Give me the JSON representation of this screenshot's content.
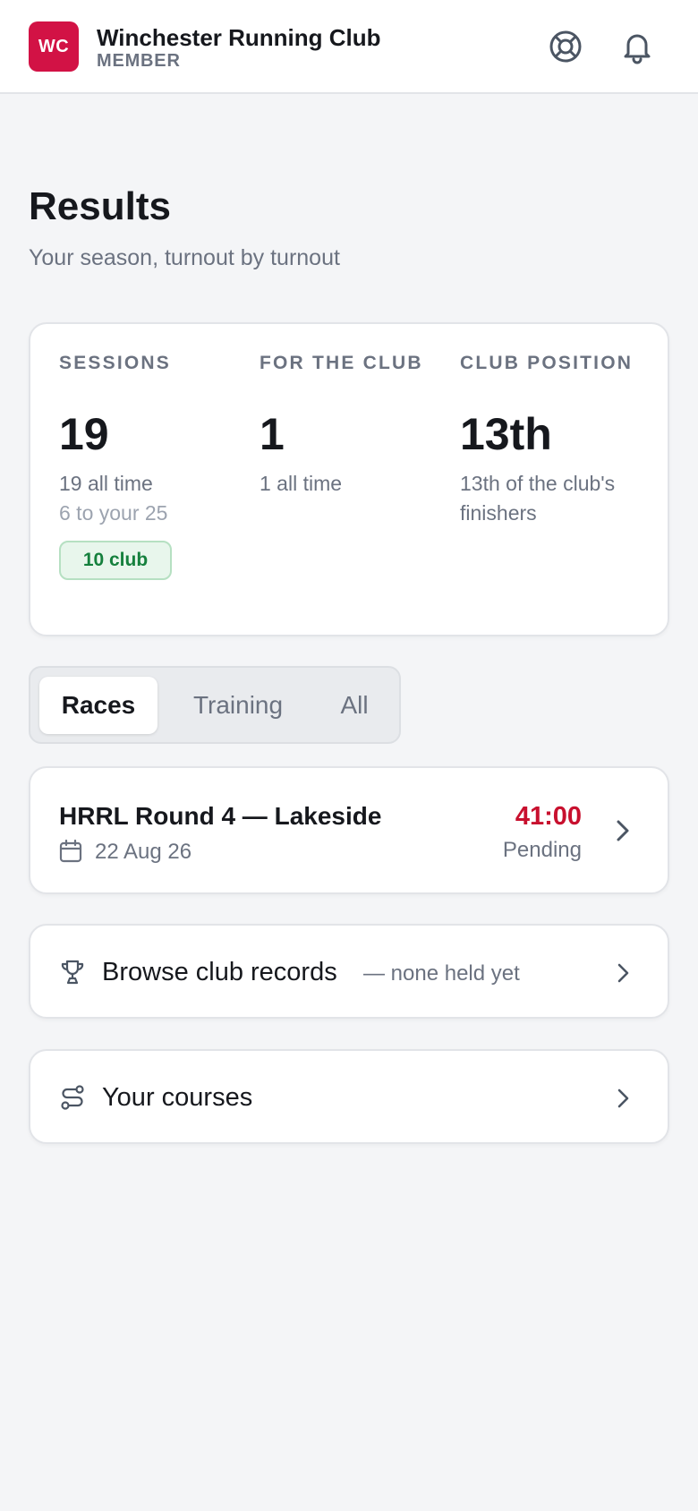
{
  "header": {
    "logo_text": "WC",
    "club_name": "Winchester Running Club",
    "role": "MEMBER",
    "icons": [
      "help-icon",
      "bell-icon"
    ],
    "brand_color": "#d21245"
  },
  "page": {
    "title": "Results",
    "subtitle": "Your season, turnout by turnout"
  },
  "stats": {
    "sessions": {
      "label": "SESSIONS",
      "value": "19",
      "sub": "19 all time",
      "sub2": "6 to your 25",
      "badge": "10 club"
    },
    "for_club": {
      "label": "FOR THE CLUB",
      "value": "1",
      "sub": "1 all time"
    },
    "club_position": {
      "label": "CLUB POSITION",
      "value": "13th",
      "sub": "13th of the club's finishers"
    }
  },
  "tabs": [
    {
      "label": "Races",
      "active": true
    },
    {
      "label": "Training",
      "active": false
    },
    {
      "label": "All",
      "active": false
    }
  ],
  "races": [
    {
      "name": "HRRL Round 4 — Lakeside",
      "date": "22 Aug 26",
      "time": "41:00",
      "status": "Pending",
      "time_color": "#c8102e"
    }
  ],
  "links": {
    "records": {
      "label": "Browse club records",
      "note": "— none held yet",
      "icon": "trophy-icon"
    },
    "courses": {
      "label": "Your courses",
      "icon": "route-icon"
    }
  }
}
